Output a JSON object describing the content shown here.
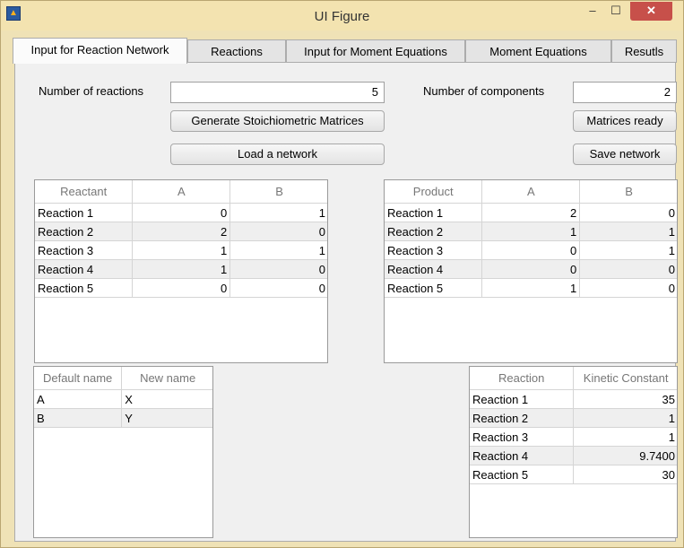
{
  "window": {
    "title": "UI Figure",
    "minimize": "–",
    "maximize": "☐",
    "close": "✕"
  },
  "tabs": [
    "Input for Reaction Network",
    "Reactions",
    "Input for Moment Equations",
    "Moment Equations",
    "Resutls"
  ],
  "form": {
    "num_reactions_label": "Number of reactions",
    "num_reactions_value": "5",
    "num_components_label": "Number of components",
    "num_components_value": "2",
    "generate_button": "Generate Stoichiometric Matrices",
    "load_button": "Load a network",
    "matrices_ready_button": "Matrices ready",
    "save_button": "Save network"
  },
  "reactant_table": {
    "headers": [
      "Reactant",
      "A",
      "B"
    ],
    "rows": [
      [
        "Reaction 1",
        "0",
        "1"
      ],
      [
        "Reaction 2",
        "2",
        "0"
      ],
      [
        "Reaction 3",
        "1",
        "1"
      ],
      [
        "Reaction 4",
        "1",
        "0"
      ],
      [
        "Reaction 5",
        "0",
        "0"
      ]
    ]
  },
  "product_table": {
    "headers": [
      "Product",
      "A",
      "B"
    ],
    "rows": [
      [
        "Reaction 1",
        "2",
        "0"
      ],
      [
        "Reaction 2",
        "1",
        "1"
      ],
      [
        "Reaction 3",
        "0",
        "1"
      ],
      [
        "Reaction 4",
        "0",
        "0"
      ],
      [
        "Reaction 5",
        "1",
        "0"
      ]
    ]
  },
  "name_table": {
    "headers": [
      "Default name",
      "New name"
    ],
    "rows": [
      [
        "A",
        "X"
      ],
      [
        "B",
        "Y"
      ]
    ]
  },
  "kinetic_table": {
    "headers": [
      "Reaction",
      "Kinetic Constant"
    ],
    "rows": [
      [
        "Reaction 1",
        "35"
      ],
      [
        "Reaction 2",
        "1"
      ],
      [
        "Reaction 3",
        "1"
      ],
      [
        "Reaction 4",
        "9.7400"
      ],
      [
        "Reaction 5",
        "30"
      ]
    ]
  }
}
